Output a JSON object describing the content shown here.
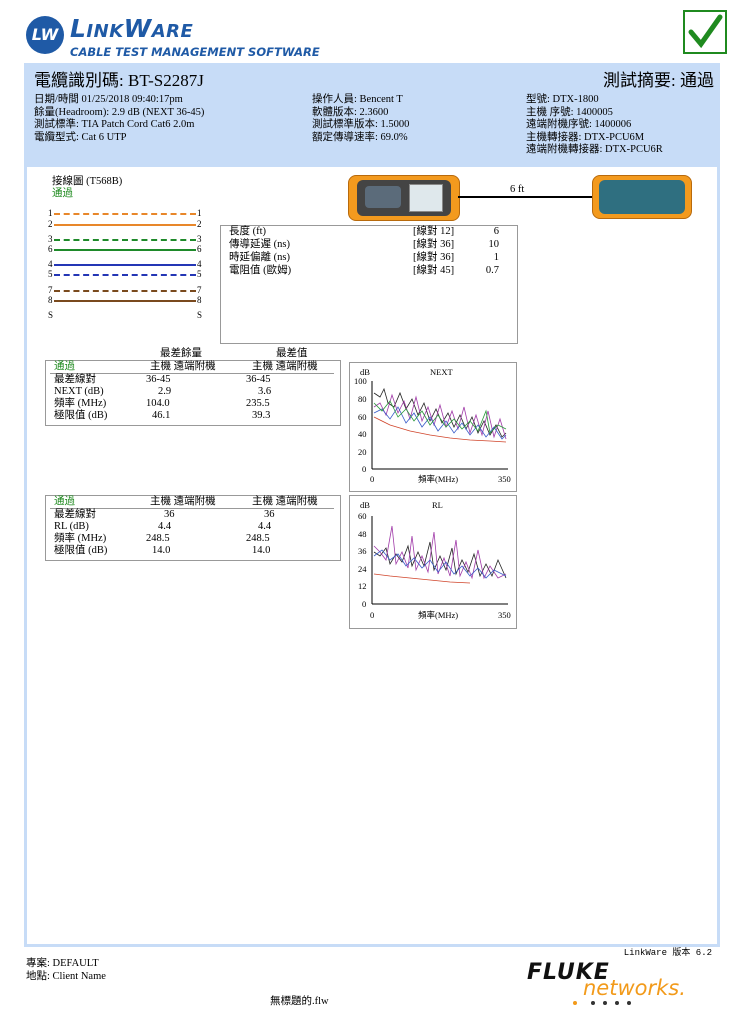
{
  "header": {
    "logo_initials": "LW",
    "logo_title": "LinkWare",
    "logo_subtitle": "CABLE TEST MANAGEMENT SOFTWARE",
    "pass_icon": "check-icon"
  },
  "summary": {
    "cable_id_label": "電纜識別碼:",
    "cable_id": "BT-S2287J",
    "result_label": "測試摘要:",
    "result": "通過",
    "col1": [
      "日期/時間 01/25/2018 09:40:17pm",
      "餘量(Headroom): 2.9 dB (NEXT 36-45)",
      "測試標準: TIA Patch Cord Cat6 2.0m",
      "電纜型式: Cat 6 UTP"
    ],
    "col2": [
      "操作人員: Bencent T",
      "軟體版本: 2.3600",
      "測試標準版本: 1.5000",
      "額定傳導速率: 69.0%"
    ],
    "col3": [
      "型號: DTX-1800",
      "主機 序號: 1400005",
      "遠端附機序號: 1400006",
      "主機轉接器: DTX-PCU6M",
      "遠端附機轉接器: DTX-PCU6R"
    ]
  },
  "wiremap": {
    "title": "接線圖 (T568B)",
    "status": "通過",
    "pins": [
      "1",
      "2",
      "3",
      "6",
      "4",
      "5",
      "7",
      "8",
      "S"
    ],
    "colors": {
      "orange": "#e8872a",
      "green": "#1e8a2a",
      "blue": "#2436b5",
      "brown": "#7a4a1e"
    },
    "cable_length_label": "6 ft"
  },
  "length_box": {
    "rows": [
      {
        "label": "長度 (ft)",
        "pair": "[線對 12]",
        "value": "6"
      },
      {
        "label": "傳導延遲 (ns)",
        "pair": "[線對 36]",
        "value": "10"
      },
      {
        "label": "時延偏離 (ns)",
        "pair": "[線對 36]",
        "value": "1"
      },
      {
        "label": "電阻值 (歐姆)",
        "pair": "[線對 45]",
        "value": "0.7"
      }
    ]
  },
  "next_table": {
    "group1": "最差餘量",
    "group2": "最差值",
    "status": "通過",
    "sub1": "主機 遠端附機",
    "sub2": "主機 遠端附機",
    "rows": [
      {
        "label": "最差線對",
        "a": "36-45",
        "b": "36-45"
      },
      {
        "label": "NEXT (dB)",
        "a": "2.9",
        "b": "3.6"
      },
      {
        "label": "頻率 (MHz)",
        "a": "104.0",
        "b": "235.5"
      },
      {
        "label": "極限值 (dB)",
        "a": "46.1",
        "b": "39.3"
      }
    ]
  },
  "rl_table": {
    "status": "通過",
    "sub1": "主機 遠端附機",
    "sub2": "主機 遠端附機",
    "rows": [
      {
        "label": "最差線對",
        "a": "36",
        "b": "36"
      },
      {
        "label": "RL (dB)",
        "a": "4.4",
        "b": "4.4"
      },
      {
        "label": "頻率 (MHz)",
        "a": "248.5",
        "b": "248.5"
      },
      {
        "label": "極限值 (dB)",
        "a": "14.0",
        "b": "14.0"
      }
    ]
  },
  "chart_data": [
    {
      "type": "line",
      "title": "NEXT",
      "ylabel": "dB",
      "xlabel": "頻率(MHz)",
      "xlim": [
        0,
        350
      ],
      "ylim": [
        0,
        100
      ],
      "yticks": [
        0,
        20,
        40,
        60,
        80,
        100
      ],
      "xticks": [
        0,
        350
      ]
    },
    {
      "type": "line",
      "title": "RL",
      "ylabel": "dB",
      "xlabel": "頻率(MHz)",
      "xlim": [
        0,
        350
      ],
      "ylim": [
        0,
        60
      ],
      "yticks": [
        0,
        12,
        24,
        36,
        48,
        60
      ],
      "xticks": [
        0,
        350
      ]
    }
  ],
  "footer": {
    "version": "LinkWare 版本 6.2",
    "project": "專案: DEFAULT",
    "location": "地點: Client Name",
    "filename": "無標題的.flw",
    "fluke": "FLUKE",
    "networks": "networks."
  }
}
